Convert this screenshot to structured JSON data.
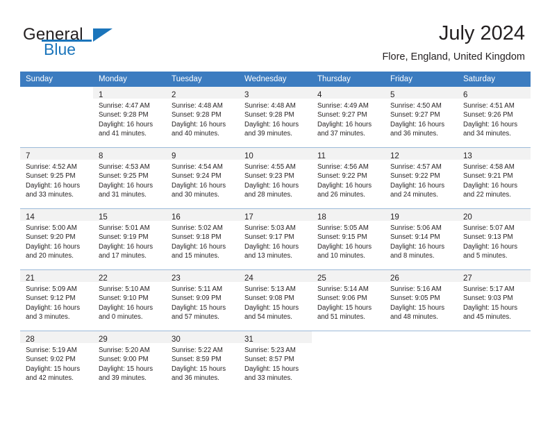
{
  "brand": {
    "word_one": "General",
    "word_two": "Blue",
    "accent_color": "#1b75bb"
  },
  "header": {
    "month_title": "July 2024",
    "location": "Flore, England, United Kingdom"
  },
  "calendar": {
    "header_bg": "#3c7cc0",
    "daynum_bg": "#f2f2f2",
    "weekday_headers": [
      "Sunday",
      "Monday",
      "Tuesday",
      "Wednesday",
      "Thursday",
      "Friday",
      "Saturday"
    ],
    "weeks": [
      [
        {
          "day": "",
          "lines": []
        },
        {
          "day": "1",
          "lines": [
            "Sunrise: 4:47 AM",
            "Sunset: 9:28 PM",
            "Daylight: 16 hours",
            "and 41 minutes."
          ]
        },
        {
          "day": "2",
          "lines": [
            "Sunrise: 4:48 AM",
            "Sunset: 9:28 PM",
            "Daylight: 16 hours",
            "and 40 minutes."
          ]
        },
        {
          "day": "3",
          "lines": [
            "Sunrise: 4:48 AM",
            "Sunset: 9:28 PM",
            "Daylight: 16 hours",
            "and 39 minutes."
          ]
        },
        {
          "day": "4",
          "lines": [
            "Sunrise: 4:49 AM",
            "Sunset: 9:27 PM",
            "Daylight: 16 hours",
            "and 37 minutes."
          ]
        },
        {
          "day": "5",
          "lines": [
            "Sunrise: 4:50 AM",
            "Sunset: 9:27 PM",
            "Daylight: 16 hours",
            "and 36 minutes."
          ]
        },
        {
          "day": "6",
          "lines": [
            "Sunrise: 4:51 AM",
            "Sunset: 9:26 PM",
            "Daylight: 16 hours",
            "and 34 minutes."
          ]
        }
      ],
      [
        {
          "day": "7",
          "lines": [
            "Sunrise: 4:52 AM",
            "Sunset: 9:25 PM",
            "Daylight: 16 hours",
            "and 33 minutes."
          ]
        },
        {
          "day": "8",
          "lines": [
            "Sunrise: 4:53 AM",
            "Sunset: 9:25 PM",
            "Daylight: 16 hours",
            "and 31 minutes."
          ]
        },
        {
          "day": "9",
          "lines": [
            "Sunrise: 4:54 AM",
            "Sunset: 9:24 PM",
            "Daylight: 16 hours",
            "and 30 minutes."
          ]
        },
        {
          "day": "10",
          "lines": [
            "Sunrise: 4:55 AM",
            "Sunset: 9:23 PM",
            "Daylight: 16 hours",
            "and 28 minutes."
          ]
        },
        {
          "day": "11",
          "lines": [
            "Sunrise: 4:56 AM",
            "Sunset: 9:22 PM",
            "Daylight: 16 hours",
            "and 26 minutes."
          ]
        },
        {
          "day": "12",
          "lines": [
            "Sunrise: 4:57 AM",
            "Sunset: 9:22 PM",
            "Daylight: 16 hours",
            "and 24 minutes."
          ]
        },
        {
          "day": "13",
          "lines": [
            "Sunrise: 4:58 AM",
            "Sunset: 9:21 PM",
            "Daylight: 16 hours",
            "and 22 minutes."
          ]
        }
      ],
      [
        {
          "day": "14",
          "lines": [
            "Sunrise: 5:00 AM",
            "Sunset: 9:20 PM",
            "Daylight: 16 hours",
            "and 20 minutes."
          ]
        },
        {
          "day": "15",
          "lines": [
            "Sunrise: 5:01 AM",
            "Sunset: 9:19 PM",
            "Daylight: 16 hours",
            "and 17 minutes."
          ]
        },
        {
          "day": "16",
          "lines": [
            "Sunrise: 5:02 AM",
            "Sunset: 9:18 PM",
            "Daylight: 16 hours",
            "and 15 minutes."
          ]
        },
        {
          "day": "17",
          "lines": [
            "Sunrise: 5:03 AM",
            "Sunset: 9:17 PM",
            "Daylight: 16 hours",
            "and 13 minutes."
          ]
        },
        {
          "day": "18",
          "lines": [
            "Sunrise: 5:05 AM",
            "Sunset: 9:15 PM",
            "Daylight: 16 hours",
            "and 10 minutes."
          ]
        },
        {
          "day": "19",
          "lines": [
            "Sunrise: 5:06 AM",
            "Sunset: 9:14 PM",
            "Daylight: 16 hours",
            "and 8 minutes."
          ]
        },
        {
          "day": "20",
          "lines": [
            "Sunrise: 5:07 AM",
            "Sunset: 9:13 PM",
            "Daylight: 16 hours",
            "and 5 minutes."
          ]
        }
      ],
      [
        {
          "day": "21",
          "lines": [
            "Sunrise: 5:09 AM",
            "Sunset: 9:12 PM",
            "Daylight: 16 hours",
            "and 3 minutes."
          ]
        },
        {
          "day": "22",
          "lines": [
            "Sunrise: 5:10 AM",
            "Sunset: 9:10 PM",
            "Daylight: 16 hours",
            "and 0 minutes."
          ]
        },
        {
          "day": "23",
          "lines": [
            "Sunrise: 5:11 AM",
            "Sunset: 9:09 PM",
            "Daylight: 15 hours",
            "and 57 minutes."
          ]
        },
        {
          "day": "24",
          "lines": [
            "Sunrise: 5:13 AM",
            "Sunset: 9:08 PM",
            "Daylight: 15 hours",
            "and 54 minutes."
          ]
        },
        {
          "day": "25",
          "lines": [
            "Sunrise: 5:14 AM",
            "Sunset: 9:06 PM",
            "Daylight: 15 hours",
            "and 51 minutes."
          ]
        },
        {
          "day": "26",
          "lines": [
            "Sunrise: 5:16 AM",
            "Sunset: 9:05 PM",
            "Daylight: 15 hours",
            "and 48 minutes."
          ]
        },
        {
          "day": "27",
          "lines": [
            "Sunrise: 5:17 AM",
            "Sunset: 9:03 PM",
            "Daylight: 15 hours",
            "and 45 minutes."
          ]
        }
      ],
      [
        {
          "day": "28",
          "lines": [
            "Sunrise: 5:19 AM",
            "Sunset: 9:02 PM",
            "Daylight: 15 hours",
            "and 42 minutes."
          ]
        },
        {
          "day": "29",
          "lines": [
            "Sunrise: 5:20 AM",
            "Sunset: 9:00 PM",
            "Daylight: 15 hours",
            "and 39 minutes."
          ]
        },
        {
          "day": "30",
          "lines": [
            "Sunrise: 5:22 AM",
            "Sunset: 8:59 PM",
            "Daylight: 15 hours",
            "and 36 minutes."
          ]
        },
        {
          "day": "31",
          "lines": [
            "Sunrise: 5:23 AM",
            "Sunset: 8:57 PM",
            "Daylight: 15 hours",
            "and 33 minutes."
          ]
        },
        {
          "day": "",
          "lines": []
        },
        {
          "day": "",
          "lines": []
        },
        {
          "day": "",
          "lines": []
        }
      ]
    ]
  }
}
